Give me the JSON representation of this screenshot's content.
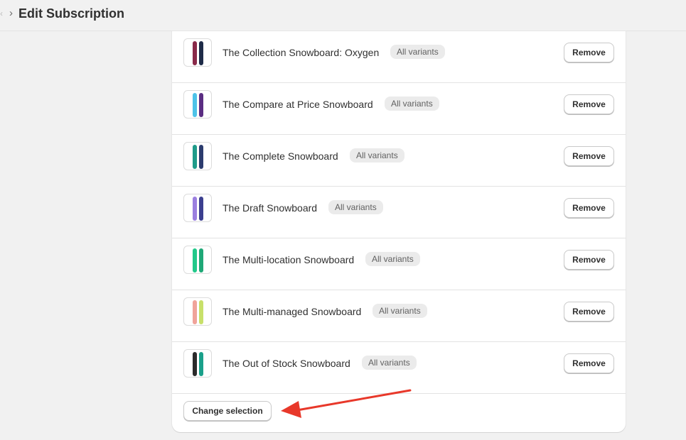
{
  "header": {
    "back_glyph": "‹",
    "breadcrumb_chevron": "›",
    "title": "Edit Subscription"
  },
  "products": [
    {
      "name": "The Collection Snowboard: Oxygen",
      "badge": "All variants",
      "action": "Remove",
      "colors": [
        "#8a2a4a",
        "#1e2b48"
      ]
    },
    {
      "name": "The Compare at Price Snowboard",
      "badge": "All variants",
      "action": "Remove",
      "colors": [
        "#4ec3e8",
        "#5a2d82"
      ]
    },
    {
      "name": "The Complete Snowboard",
      "badge": "All variants",
      "action": "Remove",
      "colors": [
        "#1f9b8a",
        "#2b3b6e"
      ]
    },
    {
      "name": "The Draft Snowboard",
      "badge": "All variants",
      "action": "Remove",
      "colors": [
        "#9b7fe0",
        "#3b3f8f"
      ]
    },
    {
      "name": "The Multi-location Snowboard",
      "badge": "All variants",
      "action": "Remove",
      "colors": [
        "#22c98a",
        "#1fa877"
      ]
    },
    {
      "name": "The Multi-managed Snowboard",
      "badge": "All variants",
      "action": "Remove",
      "colors": [
        "#f0a39a",
        "#c8e06a"
      ]
    },
    {
      "name": "The Out of Stock Snowboard",
      "badge": "All variants",
      "action": "Remove",
      "colors": [
        "#2b2b2b",
        "#1aa08a"
      ]
    }
  ],
  "footer": {
    "change_selection_label": "Change selection"
  },
  "annotation": {
    "arrow_color": "#e8382a"
  }
}
